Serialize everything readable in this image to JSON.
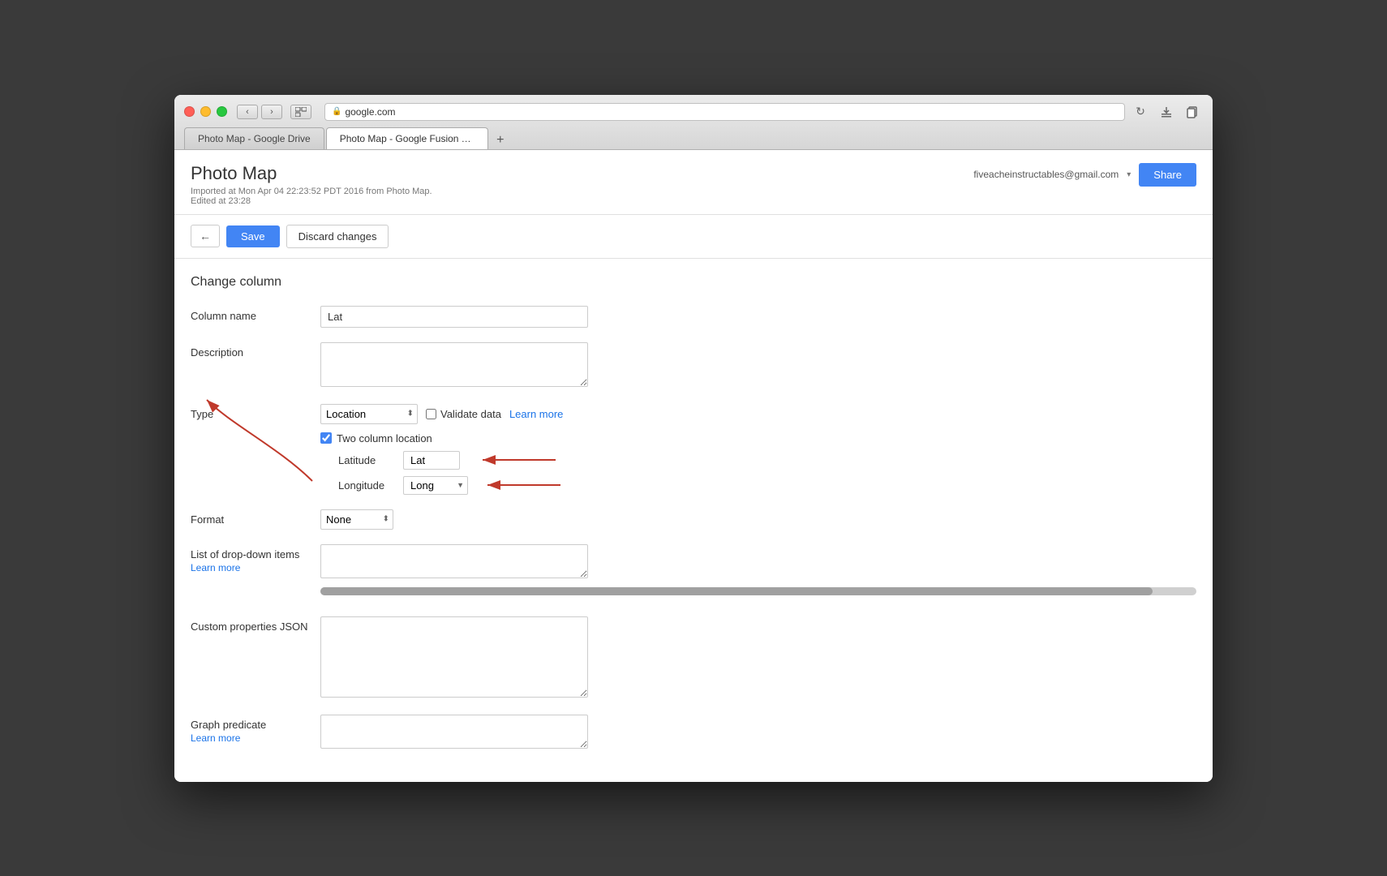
{
  "browser": {
    "url": "google.com",
    "tab1": "Photo Map - Google Drive",
    "tab2": "Photo Map - Google Fusion Tables",
    "new_tab_label": "+"
  },
  "app": {
    "title": "Photo Map",
    "meta_line1": "Imported at Mon Apr 04 22:23:52 PDT 2016 from Photo Map.",
    "meta_line2": "Edited at 23:28",
    "user_email": "fiveacheinstructables@gmail.com",
    "share_label": "Share"
  },
  "toolbar": {
    "back_label": "←",
    "save_label": "Save",
    "discard_label": "Discard changes"
  },
  "form": {
    "section_title": "Change column",
    "column_name_label": "Column name",
    "column_name_value": "Lat",
    "description_label": "Description",
    "type_label": "Type",
    "type_value": "Location",
    "validate_label": "Validate data",
    "learn_more_type": "Learn more",
    "two_col_label": "Two column location",
    "latitude_label": "Latitude",
    "latitude_value": "Lat",
    "longitude_label": "Longitude",
    "longitude_value": "Long",
    "format_label": "Format",
    "format_value": "None",
    "dropdown_items_label": "List of drop-down items",
    "dropdown_learn_more": "Learn more",
    "custom_json_label": "Custom properties JSON",
    "graph_predicate_label": "Graph predicate",
    "graph_predicate_learn_more": "Learn more"
  },
  "colors": {
    "blue": "#4285f4",
    "link_blue": "#1a73e8",
    "arrow_red": "#c0392b"
  }
}
